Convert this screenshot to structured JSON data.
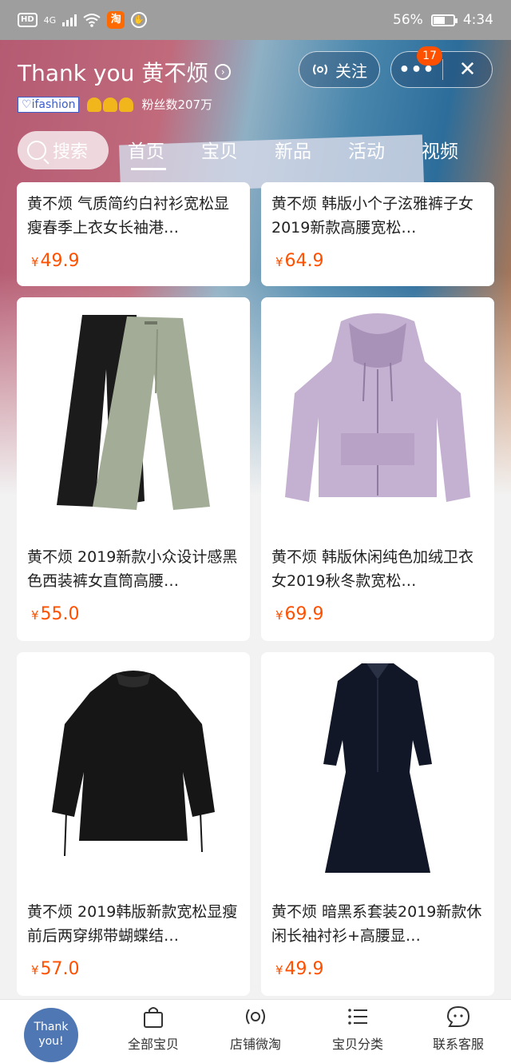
{
  "status_bar": {
    "hd": "HD",
    "network": "4G",
    "taobao_icon": "淘",
    "battery": "56%",
    "time": "4:34"
  },
  "store": {
    "name": "Thank you 黄不烦",
    "ifashion": "ifashion",
    "followers": "粉丝数207万",
    "follow_label": "关注",
    "notification_count": "17"
  },
  "search_label": "搜索",
  "tabs": [
    "首页",
    "宝贝",
    "新品",
    "活动",
    "视频"
  ],
  "products": [
    {
      "title": "黄不烦 气质简约白衬衫宽松显瘦春季上衣女长袖港…",
      "price": "49.9"
    },
    {
      "title": "黄不烦 韩版小个子泫雅裤子女2019新款高腰宽松…",
      "price": "64.9"
    },
    {
      "title": "黄不烦 2019新款小众设计感黑色西装裤女直筒高腰…",
      "price": "55.0"
    },
    {
      "title": "黄不烦 韩版休闲纯色加绒卫衣女2019秋冬款宽松…",
      "price": "69.9"
    },
    {
      "title": "黄不烦 2019韩版新款宽松显瘦前后两穿绑带蝴蝶结…",
      "price": "57.0"
    },
    {
      "title": "黄不烦 暗黑系套装2019新款休闲长袖衬衫+高腰显…",
      "price": "49.9"
    }
  ],
  "currency": "¥",
  "bottom_nav": {
    "home_line1": "Thank",
    "home_line2": "you!",
    "items": [
      "全部宝贝",
      "店铺微淘",
      "宝贝分类",
      "联系客服"
    ]
  },
  "colors": {
    "price": "#ff5000",
    "badge": "#ff5000",
    "home": "#4f77b3"
  }
}
